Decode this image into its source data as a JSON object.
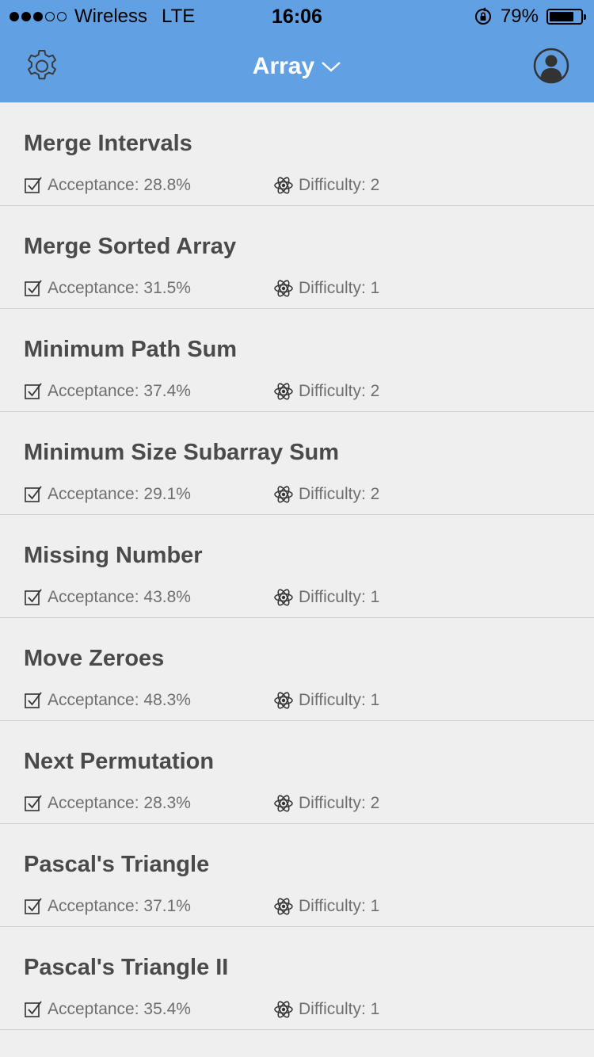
{
  "status_bar": {
    "signal_filled": 3,
    "signal_total": 5,
    "carrier": "Wireless",
    "network": "LTE",
    "time": "16:06",
    "battery_percent": "79%",
    "battery_level": 0.79
  },
  "nav": {
    "title": "Array",
    "settings_icon": "gear-icon",
    "dropdown_icon": "chevron-down-icon",
    "profile_icon": "user-icon"
  },
  "colors": {
    "header": "#62a0e4",
    "background": "#efefef",
    "title_text": "#4a4a4a",
    "meta_text": "#6f6f6f"
  },
  "problems": [
    {
      "title": "Merge Intervals",
      "acceptance": "Acceptance: 28.8%",
      "difficulty": "Difficulty: 2"
    },
    {
      "title": "Merge Sorted Array",
      "acceptance": "Acceptance: 31.5%",
      "difficulty": "Difficulty: 1"
    },
    {
      "title": "Minimum Path Sum",
      "acceptance": "Acceptance: 37.4%",
      "difficulty": "Difficulty: 2"
    },
    {
      "title": "Minimum Size Subarray Sum",
      "acceptance": "Acceptance: 29.1%",
      "difficulty": "Difficulty: 2"
    },
    {
      "title": "Missing Number",
      "acceptance": "Acceptance: 43.8%",
      "difficulty": "Difficulty: 1"
    },
    {
      "title": "Move Zeroes",
      "acceptance": "Acceptance: 48.3%",
      "difficulty": "Difficulty: 1"
    },
    {
      "title": "Next Permutation",
      "acceptance": "Acceptance: 28.3%",
      "difficulty": "Difficulty: 2"
    },
    {
      "title": "Pascal's Triangle",
      "acceptance": "Acceptance: 37.1%",
      "difficulty": "Difficulty: 1"
    },
    {
      "title": "Pascal's Triangle II",
      "acceptance": "Acceptance: 35.4%",
      "difficulty": "Difficulty: 1"
    }
  ]
}
